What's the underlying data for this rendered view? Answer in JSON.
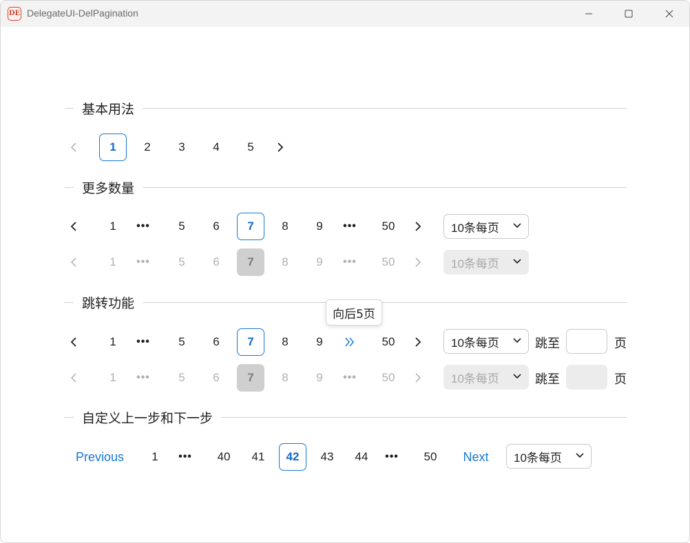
{
  "window": {
    "title": "DelegateUI-DelPagination",
    "icon_text": "DE"
  },
  "sections": {
    "basic": {
      "title": "基本用法"
    },
    "more": {
      "title": "更多数量"
    },
    "jump": {
      "title": "跳转功能"
    },
    "custom": {
      "title": "自定义上一步和下一步"
    }
  },
  "basic_row": {
    "pages": [
      "1",
      "2",
      "3",
      "4",
      "5"
    ],
    "current": "1"
  },
  "more_row": {
    "first": "1",
    "dots": "•••",
    "pages": [
      "5",
      "6",
      "7",
      "8",
      "9"
    ],
    "last": "50",
    "current": "7",
    "page_size": "10条每页"
  },
  "more_row_disabled": {
    "first": "1",
    "dots": "•••",
    "pages": [
      "5",
      "6",
      "7",
      "8",
      "9"
    ],
    "last": "50",
    "current": "7",
    "page_size": "10条每页"
  },
  "jump_row": {
    "first": "1",
    "dots": "•••",
    "pages": [
      "5",
      "6",
      "7",
      "8",
      "9"
    ],
    "last": "50",
    "current": "7",
    "page_size": "10条每页",
    "jump_label": "跳至",
    "page_suffix": "页",
    "input_value": ""
  },
  "jump_row_disabled": {
    "first": "1",
    "dots": "•••",
    "pages": [
      "5",
      "6",
      "7",
      "8",
      "9"
    ],
    "last": "50",
    "current": "7",
    "page_size": "10条每页",
    "jump_label": "跳至",
    "page_suffix": "页",
    "input_value": ""
  },
  "tooltip": {
    "text": "向后5页"
  },
  "custom_row": {
    "prev_label": "Previous",
    "next_label": "Next",
    "first": "1",
    "dots": "•••",
    "pages": [
      "40",
      "41",
      "42",
      "43",
      "44"
    ],
    "last": "50",
    "current": "42",
    "page_size": "10条每页"
  },
  "colors": {
    "accent": "#1677d4",
    "disabled_bg": "#cfcfcf",
    "divider": "#cfcfcf"
  }
}
